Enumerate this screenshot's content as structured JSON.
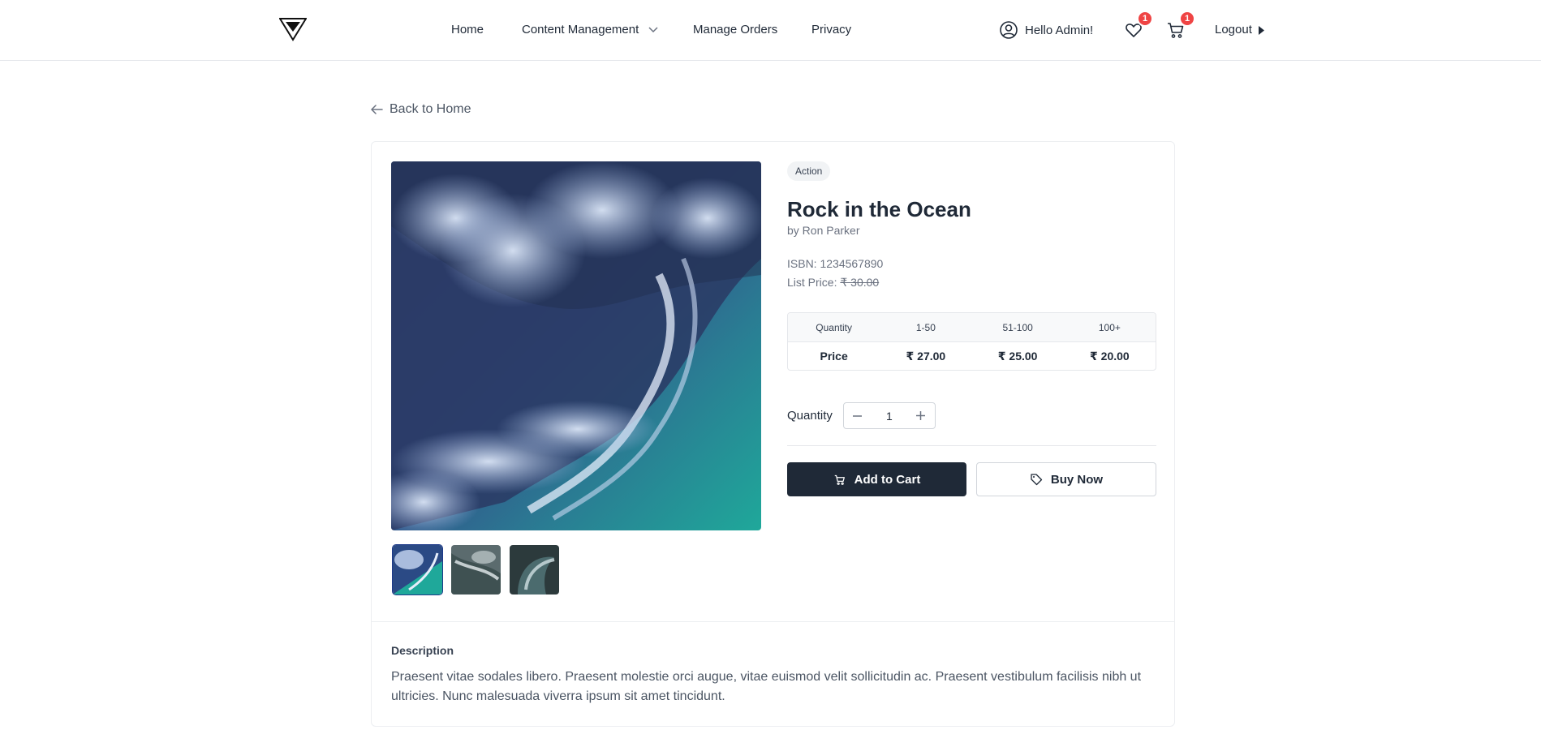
{
  "nav": {
    "home": "Home",
    "content_management": "Content Management",
    "manage_orders": "Manage Orders",
    "privacy": "Privacy",
    "user_greeting": "Hello Admin!",
    "wishlist_count": "1",
    "cart_count": "1",
    "logout": "Logout"
  },
  "back_link": "Back to Home",
  "product": {
    "genre": "Action",
    "title": "Rock in the Ocean",
    "author": "by Ron Parker",
    "isbn_label": "ISBN: ",
    "isbn": "1234567890",
    "list_price_label": "List Price: ",
    "list_price": "₹ 30.00",
    "thumbnails": [
      "thumbnail-1",
      "thumbnail-2",
      "thumbnail-3"
    ],
    "thumbnail_selected": 0
  },
  "price_table": {
    "headers": [
      "Quantity",
      "1-50",
      "51-100",
      "100+"
    ],
    "row": [
      "Price",
      "₹ 27.00",
      "₹ 25.00",
      "₹ 20.00"
    ]
  },
  "quantity": {
    "label": "Quantity",
    "value": "1"
  },
  "buttons": {
    "add_to_cart": "Add to Cart",
    "buy_now": "Buy Now"
  },
  "description": {
    "heading": "Description",
    "text": "Praesent vitae sodales libero. Praesent molestie orci augue, vitae euismod velit sollicitudin ac. Praesent vestibulum facilisis nibh ut ultricies. Nunc malesuada viverra ipsum sit amet tincidunt."
  },
  "colors": {
    "primary_button": "#1f2937",
    "badge": "#ef4444",
    "border": "#e5e7eb"
  }
}
